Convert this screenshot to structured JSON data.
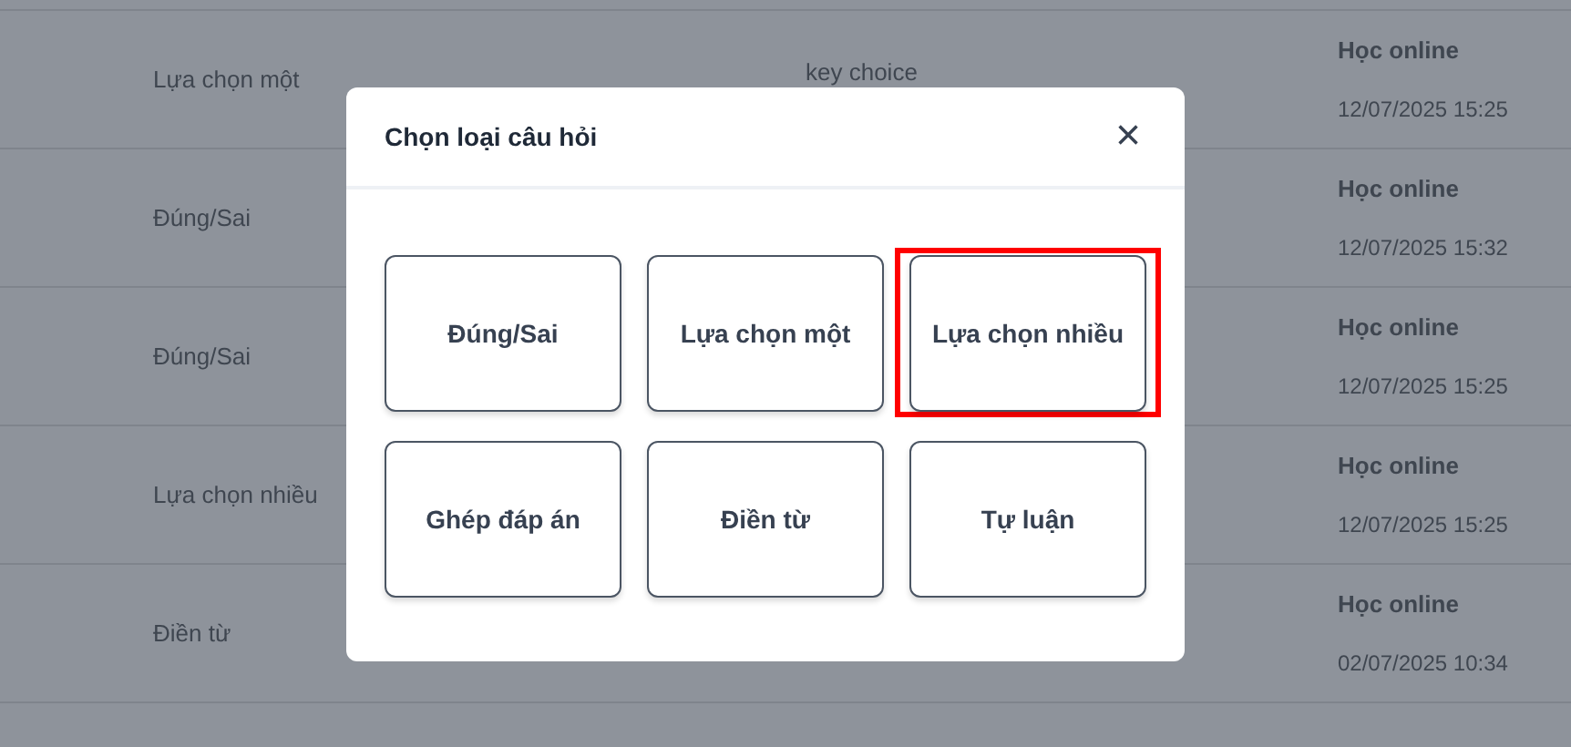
{
  "table": {
    "rows": [
      {
        "name": "Lựa chọn một",
        "key": "key choice",
        "source": "Học online",
        "time": "12/07/2025 15:25"
      },
      {
        "name": "Đúng/Sai",
        "source": "Học online",
        "time": "12/07/2025 15:32"
      },
      {
        "name": "Đúng/Sai",
        "source": "Học online",
        "time": "12/07/2025 15:25"
      },
      {
        "name": "Lựa chọn nhiều",
        "source": "Học online",
        "time": "12/07/2025 15:25"
      },
      {
        "name": "Điền từ",
        "source": "Học online",
        "time": "02/07/2025 10:34"
      }
    ]
  },
  "dialog": {
    "title": "Chọn loại câu hỏi",
    "close": "×",
    "options": [
      {
        "label": "Đúng/Sai",
        "highlighted": false
      },
      {
        "label": "Lựa chọn một",
        "highlighted": false
      },
      {
        "label": "Lựa chọn nhiều",
        "highlighted": true
      },
      {
        "label": "Ghép đáp án",
        "highlighted": false
      },
      {
        "label": "Điền từ",
        "highlighted": false
      },
      {
        "label": "Tự luận",
        "highlighted": false
      }
    ]
  }
}
